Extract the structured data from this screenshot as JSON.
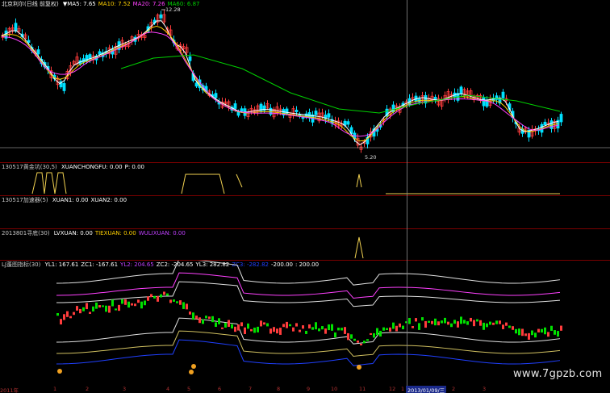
{
  "colors": {
    "up": "#ff3c3c",
    "down": "#00e0ff",
    "ma5": "#ffffff",
    "ma10": "#ffd000",
    "ma20": "#ff40ff",
    "ma60": "#00d000",
    "yellow": "#f0d050",
    "grid": "#7a0000",
    "green": "#00e000",
    "blue": "#2040ff"
  },
  "panel1": {
    "title": "北京利尔(日线 前复权)",
    "ma_labels": [
      {
        "text": "▼MA5: 7.65",
        "color": "#ffffff"
      },
      {
        "text": "MA10: 7.52",
        "color": "#ffd000"
      },
      {
        "text": "MA20: 7.26",
        "color": "#ff40ff"
      },
      {
        "text": "MA60: 6.87",
        "color": "#00d000"
      }
    ],
    "high_label": "12.28",
    "low_label": "5.20"
  },
  "panel2": {
    "title": "130517黄金坑(30,5)",
    "items": [
      {
        "text": "XUANCHONGFU: 0.00",
        "color": "#ffffff"
      },
      {
        "text": "P: 0.00",
        "color": "#ffffff"
      }
    ]
  },
  "panel3": {
    "title": "130517加速器(5)",
    "items": [
      {
        "text": "XUAN1: 0.00",
        "color": "#ffffff"
      },
      {
        "text": "XUAN2: 0.00",
        "color": "#ffffff"
      }
    ]
  },
  "panel4": {
    "title": "2013801寻底(30)",
    "items": [
      {
        "text": "LVXUAN: 0.00",
        "color": "#ffffff"
      },
      {
        "text": "TIEXUAN: 0.00",
        "color": "#ffd000"
      },
      {
        "text": "WULIXUAN: 0.00",
        "color": "#c040ff"
      }
    ]
  },
  "panel5": {
    "title": "LJ蓬图指标(30)",
    "items": [
      {
        "text": "YL1: 167.61",
        "color": "#ffffff"
      },
      {
        "text": "ZC1: -167.61",
        "color": "#ffffff"
      },
      {
        "text": "YL2: 204.65",
        "color": "#c040ff"
      },
      {
        "text": "ZC2: -204.65",
        "color": "#ffffff"
      },
      {
        "text": "YL3: 282.82",
        "color": "#ffffff"
      },
      {
        "text": "ZC3: -282.82",
        "color": "#2040ff"
      },
      {
        "text": "-200.00",
        "color": "#ffffff"
      },
      {
        "text": ": 200.00",
        "color": "#ffffff"
      }
    ]
  },
  "x_axis": [
    "2011年",
    "1",
    "2",
    "3",
    "4",
    "5",
    "6",
    "7",
    "8",
    "9",
    "10",
    "11",
    "12",
    "1",
    "2013/01/09/三",
    "2",
    "3"
  ],
  "x_axis_highlight_index": 14,
  "watermark": "www.7gpzb.com"
}
